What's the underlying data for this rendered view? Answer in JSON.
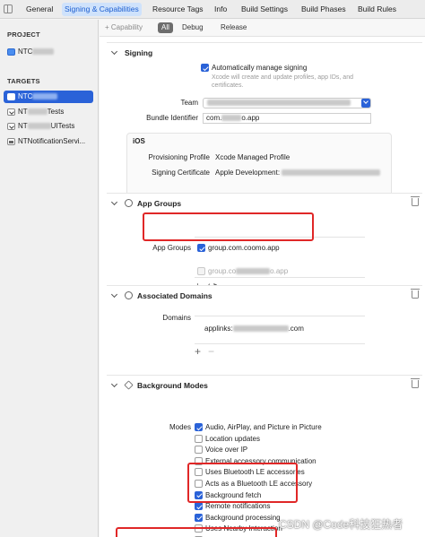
{
  "tabs": [
    {
      "label": "General",
      "active": false
    },
    {
      "label": "Signing & Capabilities",
      "active": true
    },
    {
      "label": "Resource Tags",
      "active": false
    },
    {
      "label": "Info",
      "active": false
    },
    {
      "label": "Build Settings",
      "active": false
    },
    {
      "label": "Build Phases",
      "active": false
    },
    {
      "label": "Build Rules",
      "active": false
    }
  ],
  "sidebar": {
    "project_header": "PROJECT",
    "project_item": "NTC",
    "targets_header": "TARGETS",
    "targets": [
      {
        "label": "NTC",
        "icon": "app-icon",
        "selected": true
      },
      {
        "label": "Tests",
        "prefix": "NT",
        "icon": "test-icon",
        "selected": false
      },
      {
        "label": "UITests",
        "prefix": "NT",
        "icon": "test-icon",
        "selected": false
      },
      {
        "label": "NTNotificationServi...",
        "icon": "extension-icon",
        "selected": false
      }
    ]
  },
  "toolbar": {
    "add_capability": "+ Capability",
    "filters": [
      {
        "label": "All",
        "active": true
      },
      {
        "label": "Debug",
        "active": false
      },
      {
        "label": "Release",
        "active": false
      }
    ]
  },
  "signing": {
    "title": "Signing",
    "auto_manage_label": "Automatically manage signing",
    "auto_manage_checked": true,
    "hint_line1": "Xcode will create and update profiles, app IDs, and",
    "hint_line2": "certificates.",
    "team_label": "Team",
    "bundle_label": "Bundle Identifier",
    "bundle_prefix": "com.",
    "bundle_suffix": "o.app",
    "ios": {
      "title": "iOS",
      "profile_label": "Provisioning Profile",
      "profile_value": "Xcode Managed Profile",
      "cert_label": "Signing Certificate",
      "cert_value": "Apple Development:"
    }
  },
  "app_groups": {
    "title": "App Groups",
    "label": "App Groups",
    "items": [
      {
        "label": "group.com.coomo.app",
        "checked": true,
        "dim": false
      },
      {
        "label": "group.co",
        "suffix": "o.app",
        "checked": false,
        "dim": true
      }
    ]
  },
  "associated_domains": {
    "title": "Associated Domains",
    "label": "Domains",
    "domain_prefix": "applinks:",
    "domain_suffix": ".com"
  },
  "background_modes": {
    "title": "Background Modes",
    "label": "Modes",
    "modes": [
      {
        "label": "Audio, AirPlay, and Picture in Picture",
        "checked": true
      },
      {
        "label": "Location updates",
        "checked": false
      },
      {
        "label": "Voice over IP",
        "checked": false
      },
      {
        "label": "External accessory communication",
        "checked": false
      },
      {
        "label": "Uses Bluetooth LE accessories",
        "checked": false
      },
      {
        "label": "Acts as a Bluetooth LE accessory",
        "checked": false
      },
      {
        "label": "Background fetch",
        "checked": true
      },
      {
        "label": "Remote notifications",
        "checked": true
      },
      {
        "label": "Background processing",
        "checked": true
      },
      {
        "label": "Uses Nearby Interaction",
        "checked": false
      },
      {
        "label": "Push to Talk",
        "checked": false
      }
    ]
  },
  "watermark": "CSDN @Code科技狂热者",
  "colors": {
    "accent": "#2a62d8",
    "highlight_box": "#e02727",
    "active_tab": "#cfe2fb"
  }
}
